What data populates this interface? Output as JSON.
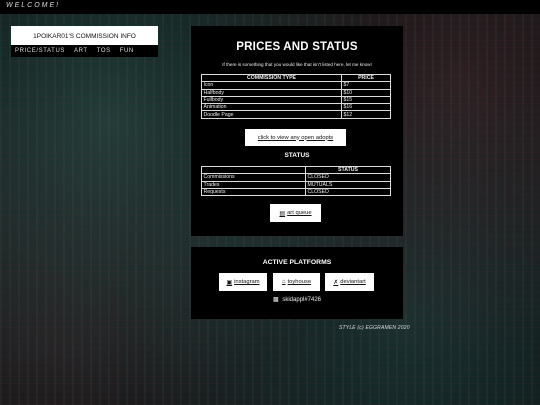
{
  "topbar": {
    "welcome": "WELCOME!"
  },
  "site": {
    "title": "1POIKAR01'S COMMISSION INFO"
  },
  "nav": {
    "items": [
      "PRICE/STATUS",
      "ART",
      "TOS",
      "FUN"
    ]
  },
  "prices": {
    "heading": "PRICES AND STATUS",
    "intro": "If there is something that you would like that isn't listed here, let me know!",
    "columns": [
      "COMMISSION TYPE",
      "PRICE"
    ],
    "rows": [
      [
        "Icon",
        "$7"
      ],
      [
        "Halfbody",
        "$10"
      ],
      [
        "Fullbody",
        "$15"
      ],
      [
        "Animation",
        "$16"
      ],
      [
        "Doodle Page",
        "$12"
      ]
    ],
    "adopts_link": "click to view any open adopts"
  },
  "status": {
    "heading": "STATUS",
    "columns": [
      "",
      "STATUS"
    ],
    "rows": [
      [
        "Commissions",
        "CLOSED"
      ],
      [
        "Trades",
        "MUTUALS"
      ],
      [
        "Requests",
        "CLOSED"
      ]
    ],
    "queue_link": "art queue"
  },
  "platforms": {
    "heading": "ACTIVE PLATFORMS",
    "instagram": "instagram",
    "toyhouse": "toyhouse",
    "deviantart": "deviantart",
    "discord": "skidappl#7426",
    "icons": [
      "instagram-icon",
      "home-icon",
      "deviantart-icon",
      "discord-icon",
      "queue-icon"
    ]
  },
  "footer": {
    "credit": "STYLE (c) EGGRAMEN 2020"
  }
}
